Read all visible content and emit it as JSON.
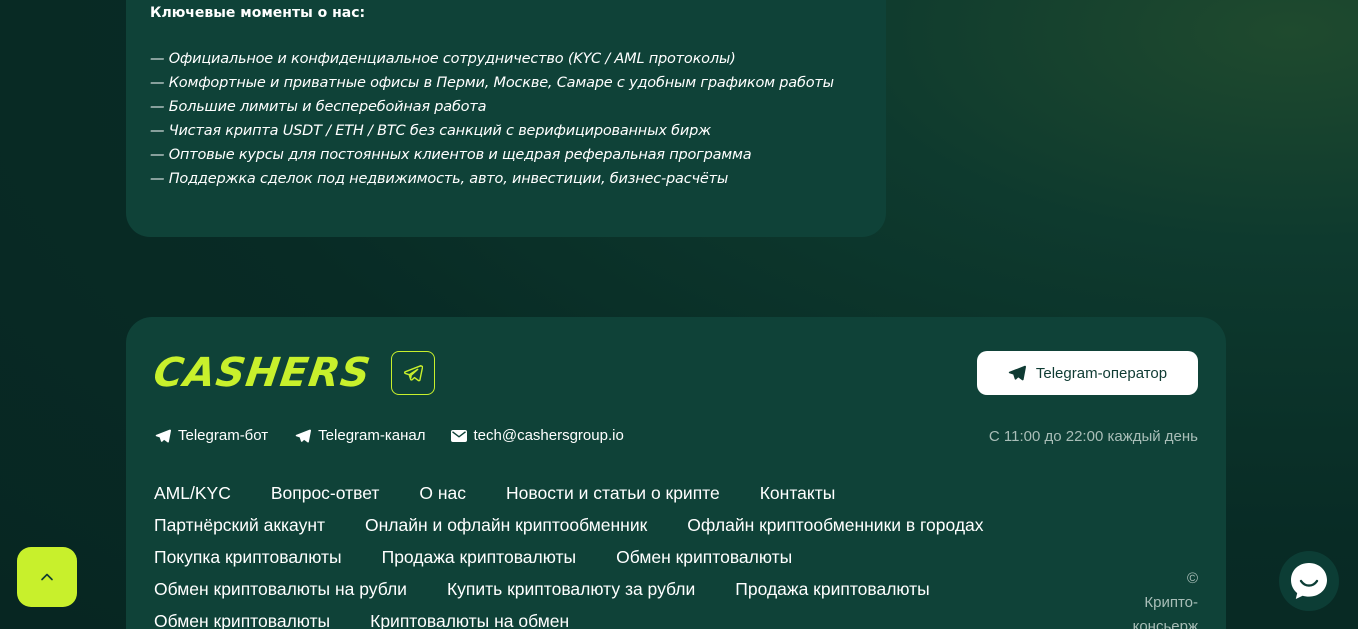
{
  "about": {
    "title": "Ключевые моменты о нас:",
    "points": [
      "— Официальное и конфиденциальное сотрудничество (KYC / AML протоколы)",
      "— Комфортные и приватные офисы в Перми, Москве, Самаре с удобным графиком работы",
      "— Большие лимиты и бесперебойная работа",
      "— Чистая крипта USDT / ETH / BTC без санкций с верифицированных бирж",
      "— Оптовые курсы для постоянных клиентов и щедрая реферальная программа",
      "— Поддержка сделок под недвижимость, авто, инвестиции, бизнес-расчёты"
    ]
  },
  "footer": {
    "brand": "CASHERS",
    "operator_button": "Telegram-оператор",
    "contacts": {
      "bot": "Telegram-бот",
      "channel": "Telegram-канал",
      "email": "tech@cashersgroup.io"
    },
    "hours": "С 11:00 до 22:00 каждый день",
    "nav": [
      [
        "AML/KYC",
        "Вопрос-ответ",
        "О нас",
        "Новости и статьи о крипте",
        "Контакты"
      ],
      [
        "Партнёрский аккаунт",
        "Онлайн и офлайн криптообменник",
        "Офлайн криптообменники в городах"
      ],
      [
        "Покупка криптовалюты",
        "Продажа криптовалюты",
        "Обмен криптовалюты"
      ],
      [
        "Обмен криптовалюты на рубли",
        "Купить криптовалюту за рубли",
        "Продажа криптовалюты"
      ],
      [
        "Обмен криптовалюты",
        "Криптовалюты на обмен"
      ]
    ],
    "copyright_lines": [
      "©",
      "Крипто-",
      "консьерж"
    ]
  },
  "colors": {
    "accent": "#c8f02c",
    "card": "#0f4238",
    "background": "#082b25",
    "muted_text": "#a9beb8"
  },
  "icons": {
    "telegram": "telegram-icon",
    "mail": "mail-icon",
    "chevron_up": "chevron-up-icon",
    "chat": "chat-icon"
  }
}
